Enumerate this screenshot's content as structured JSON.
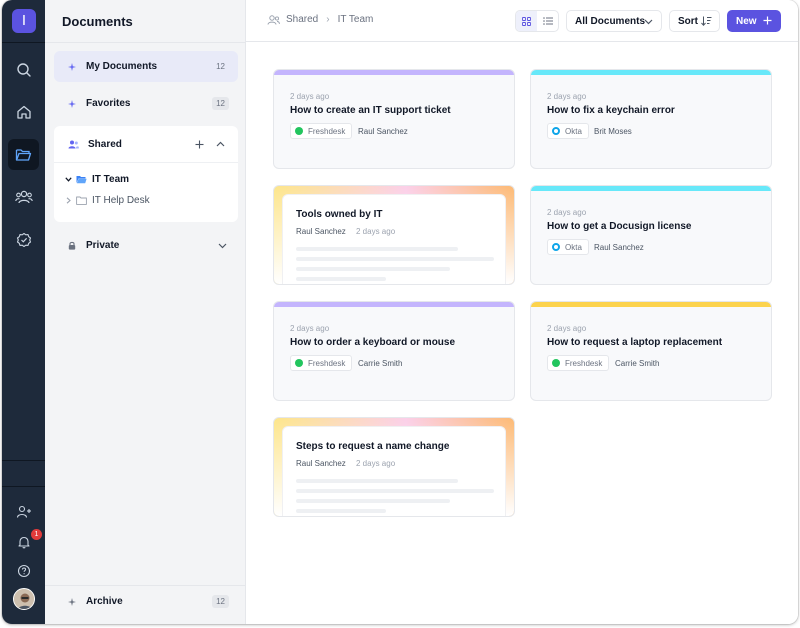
{
  "app": {
    "logo_letter": "I"
  },
  "sidebar": {
    "title": "Documents",
    "items": [
      {
        "label": "My Documents",
        "count": "12"
      },
      {
        "label": "Favorites",
        "count": "12"
      }
    ],
    "shared": {
      "label": "Shared",
      "folders": [
        {
          "label": "IT Team"
        },
        {
          "label": "IT Help Desk"
        }
      ]
    },
    "private": {
      "label": "Private"
    },
    "archive": {
      "label": "Archive",
      "count": "12"
    }
  },
  "rail": {
    "notification_count": "1"
  },
  "topbar": {
    "breadcrumb": [
      "Shared",
      "IT Team"
    ],
    "filter_label": "All Documents",
    "sort_label": "Sort",
    "new_label": "New"
  },
  "cards": [
    {
      "meta": "2 days ago",
      "title": "How to create an IT support ticket",
      "source": "Freshdesk",
      "owner": "Raul Sanchez"
    },
    {
      "meta": "2 days ago",
      "title": "How to fix a keychain error",
      "source": "Okta",
      "owner": "Brit Moses"
    },
    {
      "title": "Tools owned by IT",
      "owner": "Raul Sanchez",
      "meta": "2 days ago"
    },
    {
      "meta": "2 days ago",
      "title": "How to get a Docusign license",
      "source": "Okta",
      "owner": "Raul Sanchez"
    },
    {
      "meta": "2 days ago",
      "title": "How to order a keyboard or mouse",
      "source": "Freshdesk",
      "owner": "Carrie Smith"
    },
    {
      "meta": "2 days ago",
      "title": "How to request a laptop replacement",
      "source": "Freshdesk",
      "owner": "Carrie Smith"
    },
    {
      "title": "Steps to request a name change",
      "owner": "Raul Sanchez",
      "meta": "2 days ago"
    }
  ],
  "colors": {
    "accent": "#5b53e0",
    "purple_bar": "#c4b5fd",
    "cyan_bar": "#67e8f9",
    "yellow_bar": "#fcd34d",
    "freshdesk": "#22c55e",
    "okta": "#0ea5e9"
  }
}
